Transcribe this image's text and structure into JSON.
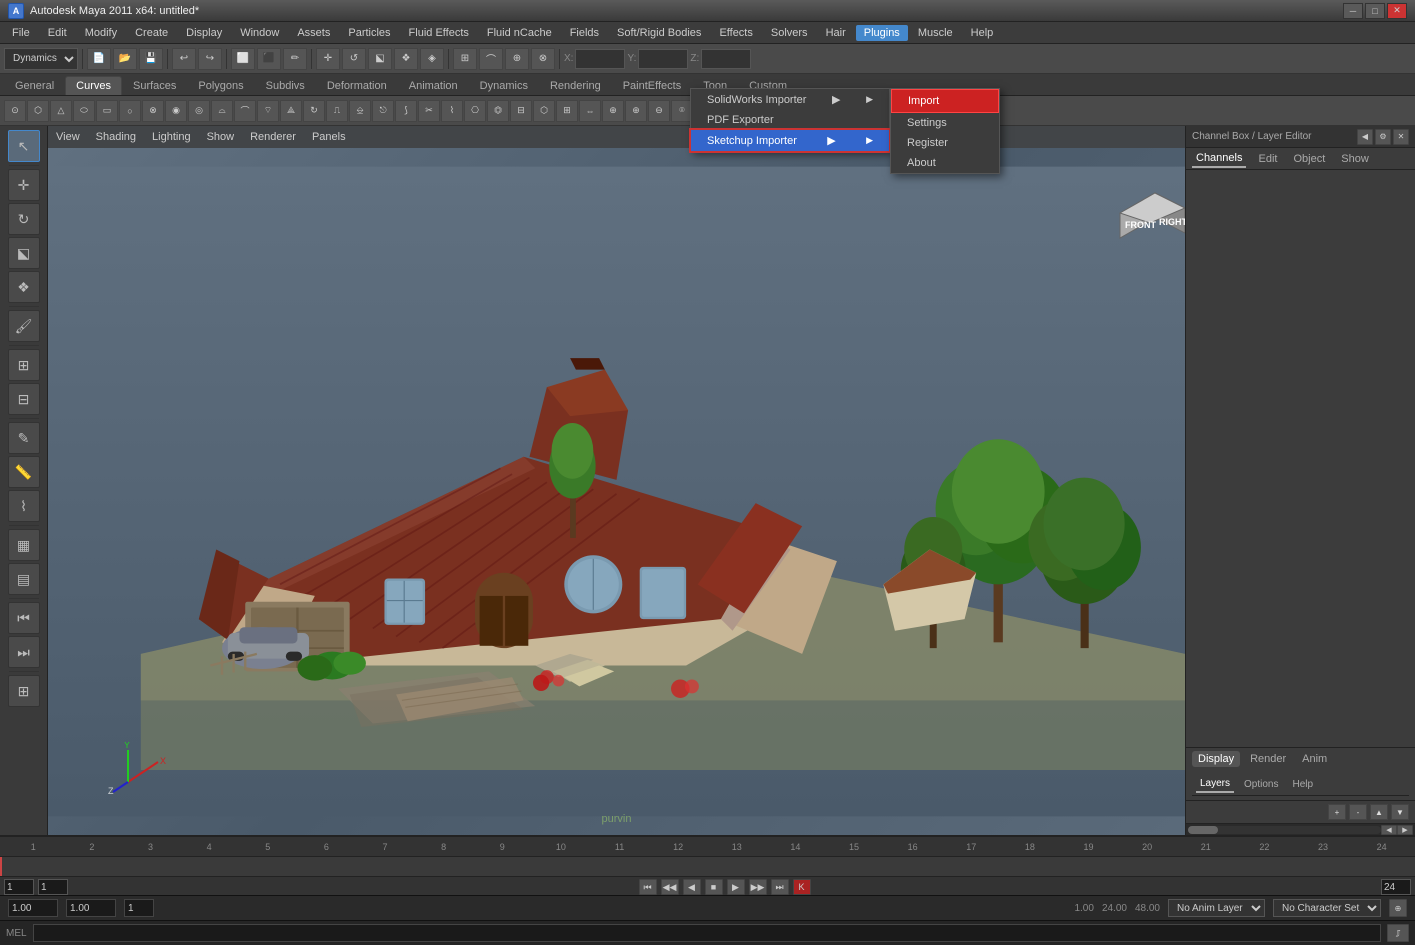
{
  "app": {
    "title": "Autodesk Maya 2011 x64: untitled*",
    "icon_text": "A"
  },
  "titlebar": {
    "title": "Autodesk Maya 2011 x64: untitled*",
    "minimize": "─",
    "maximize": "□",
    "close": "✕"
  },
  "menubar": {
    "items": [
      "File",
      "Edit",
      "Modify",
      "Create",
      "Display",
      "Window",
      "Assets",
      "Particles",
      "Fluid Effects",
      "Fluid nCache",
      "Fields",
      "Soft/Rigid Bodies",
      "Effects",
      "Solvers",
      "Hair",
      "Plugins",
      "Muscle",
      "Help"
    ]
  },
  "toolbar1": {
    "dropdown_label": "Dynamics",
    "x_label": "X:",
    "y_label": "Y:",
    "z_label": "Z:"
  },
  "tabs": {
    "items": [
      "General",
      "Curves",
      "Surfaces",
      "Polygons",
      "Subdivs",
      "Deformation",
      "Animation",
      "Dynamics",
      "Rendering",
      "PaintEffects",
      "Toon",
      "Custom"
    ]
  },
  "viewport_menu": {
    "items": [
      "View",
      "Shading",
      "Lighting",
      "Show",
      "Renderer",
      "Panels"
    ]
  },
  "compass": {
    "front": "FRONT",
    "right": "RIGHT"
  },
  "watermark": {
    "text": "purvin"
  },
  "right_panel": {
    "header": "Channel Box / Layer Editor",
    "nav_tabs": [
      "Channels",
      "Edit",
      "Object",
      "Show"
    ],
    "bottom_tabs": [
      "Display",
      "Render",
      "Anim"
    ],
    "layer_tabs": [
      "Layers",
      "Options",
      "Help"
    ]
  },
  "plugins_menu": {
    "items": [
      {
        "label": "SolidWorks Importer",
        "has_sub": true
      },
      {
        "label": "PDF Exporter",
        "has_sub": false
      },
      {
        "label": "Sketchup Importer",
        "has_sub": true,
        "highlighted": true
      }
    ]
  },
  "sketchup_submenu": {
    "items": [
      {
        "label": "Import",
        "highlighted": true
      },
      {
        "label": "Settings"
      },
      {
        "label": "Register"
      },
      {
        "label": "About"
      }
    ]
  },
  "timeline": {
    "start": "1",
    "end": "24",
    "current_frame": "1",
    "ruler_marks": [
      "1",
      "2",
      "3",
      "4",
      "5",
      "6",
      "7",
      "8",
      "9",
      "10",
      "11",
      "12",
      "13",
      "14",
      "15",
      "16",
      "17",
      "18",
      "19",
      "20",
      "21",
      "22",
      "23",
      "24"
    ]
  },
  "statusbar": {
    "val1": "1.00",
    "val2": "1.00",
    "frame_label": "1",
    "frame_end": "24",
    "time1": "1.00",
    "time2": "24.00",
    "time3": "48.00",
    "anim_layer": "No Anim Layer",
    "char_set": "No Character Set"
  },
  "cmdline": {
    "label": "MEL",
    "script_label": "//",
    "placeholder": ""
  }
}
